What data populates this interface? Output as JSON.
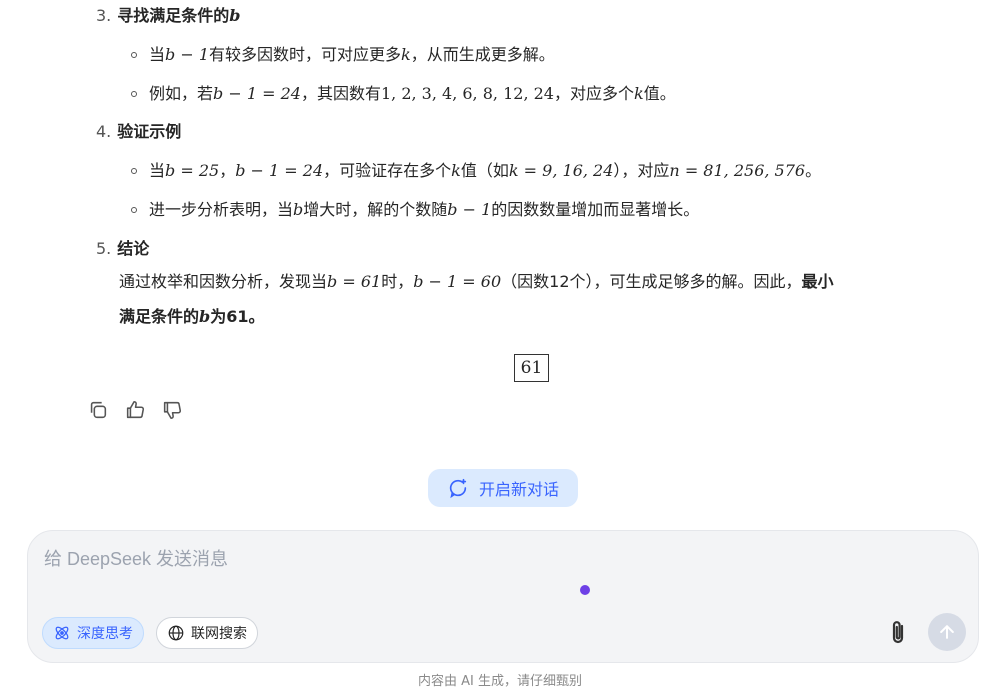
{
  "sections": [
    {
      "num": "3.",
      "title_pre": "寻找满足条件的",
      "title_var": "b"
    },
    {
      "num": "4.",
      "title": "验证示例"
    },
    {
      "num": "5.",
      "title": "结论"
    }
  ],
  "s3_b1": {
    "t1": "当",
    "m1": "b − 1",
    "t2": "有较多因数时，可对应更多",
    "m2": "k",
    "t3": "，从而生成更多解。"
  },
  "s3_b2": {
    "t1": "例如，若",
    "m1": "b − 1 = 24",
    "t2": "，其因数有",
    "m2": "1, 2, 3, 4, 6, 8, 12, 24",
    "t3": "，对应多个",
    "m3": "k",
    "t4": "值。"
  },
  "s4_b1": {
    "t1": "当",
    "m1": "b = 25",
    "t2": "，",
    "m2": "b − 1 = 24",
    "t3": "，可验证存在多个",
    "m3": "k",
    "t4": "值（如",
    "m4": "k = 9, 16, 24",
    "t5": "），对应",
    "m5": "n = 81, 256, 576",
    "t6": "。"
  },
  "s4_b2": {
    "t1": "进一步分析表明，当",
    "m1": "b",
    "t2": "增大时，解的个数随",
    "m3": "b − 1",
    "t3": "的因数数量增加而显著增长。"
  },
  "s5": {
    "t1": "通过枚举和因数分析，发现当",
    "m1": "b = 61",
    "t2": "时，",
    "m2": "b − 1 = 60",
    "t3": "（因数12个），可生成足够多的解。因此，",
    "bold1": "最小",
    "bold2": "满足条件的",
    "bvar": "b",
    "bold3": "为61。"
  },
  "answer": "61",
  "new_chat_label": "开启新对话",
  "composer": {
    "placeholder": "给 DeepSeek 发送消息",
    "deep_think": "深度思考",
    "web_search": "联网搜索"
  },
  "footer_note": "内容由 AI 生成，请仔细甄别",
  "colors": {
    "accent": "#3964fe",
    "accent_bg": "#dbeafe",
    "dot": "#6d40e6"
  }
}
